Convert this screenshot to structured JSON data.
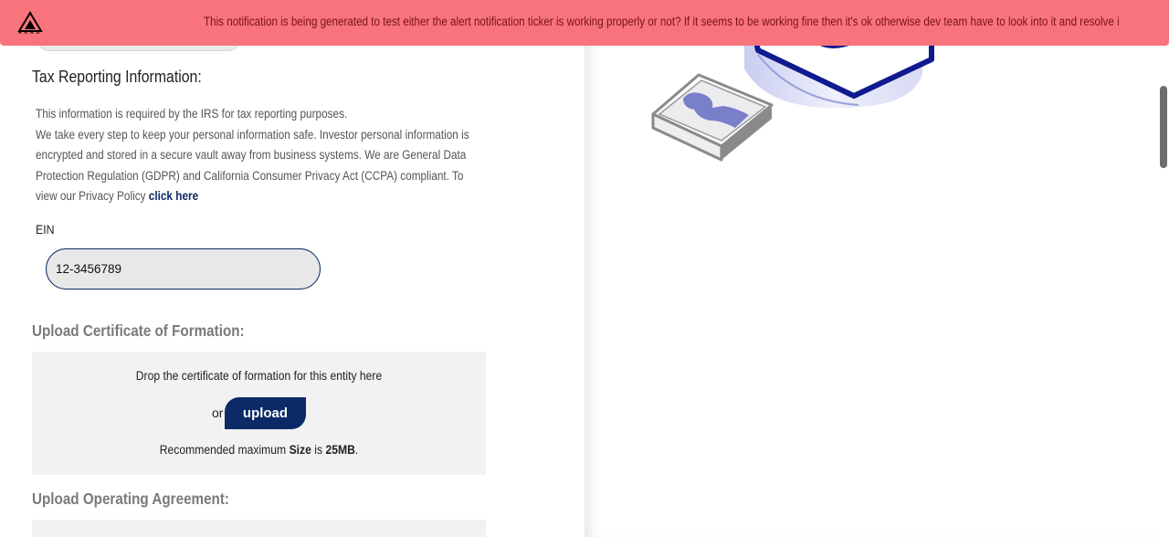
{
  "notification": {
    "brand": "AKRU",
    "message": "This notification is being generated to test either the alert notification ticker is working properly or not? If it seems to be working fine then it's ok otherwise dev team have to look into it and resolve i"
  },
  "tax_section": {
    "title": "Tax Reporting Information:",
    "line1": "This information is required by the IRS for tax reporting purposes.",
    "line2": "We take every step to keep your personal information safe. Investor personal information is encrypted and stored in a secure vault away from business systems. We are General Data Protection Regulation (GDPR) and California Consumer Privacy Act (CCPA) compliant. To view our Privacy Policy",
    "privacy_link": "click here",
    "ein_label": "EIN",
    "ein_value": "12-3456789"
  },
  "certificate_upload": {
    "title": "Upload Certificate of Formation:",
    "drop_text": "Drop the certificate of formation for this entity here",
    "or_text": "or",
    "upload_label": "upload",
    "rec_prefix": "Recommended maximum",
    "rec_size_word": "Size",
    "rec_is": "is",
    "rec_value": "25MB",
    "rec_suffix": "."
  },
  "operating_upload": {
    "title": "Upload Operating Agreement:"
  },
  "colors": {
    "ticker_bg": "#f8747c",
    "accent": "#0c2a66",
    "field_bg": "#e8e8e8",
    "drop_bg": "#f2f2f2"
  }
}
